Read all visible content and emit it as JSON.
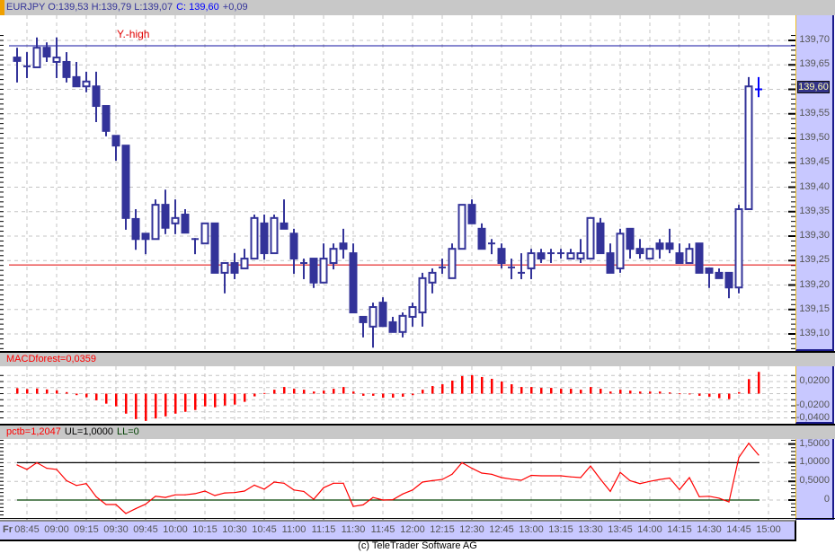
{
  "header": {
    "symbol_ohl": "EURJPY O:139,53 H:139,79 L:139,07",
    "close": "C: 139,60",
    "change": "+0,09",
    "accent": "#f0a000"
  },
  "price_panel": {
    "annotation": "Y.-high",
    "y_high": 139.689,
    "y_low": 139.241,
    "last_price_tag": "139,60",
    "axis_labels": [
      "139,70",
      "139,65",
      "139,60",
      "139,55",
      "139,50",
      "139,45",
      "139,40",
      "139,35",
      "139,30",
      "139,25",
      "139,20",
      "139,15",
      "139,10"
    ],
    "axis_values": [
      139.7,
      139.65,
      139.6,
      139.55,
      139.5,
      139.45,
      139.4,
      139.35,
      139.3,
      139.25,
      139.2,
      139.15,
      139.1
    ],
    "colors": {
      "candle": "#333399",
      "last": "#0000ff",
      "y_high_line": "#1010a0",
      "y_low_line": "#e00000",
      "annotation": "#e00000"
    },
    "candles_ohlc": [
      [
        139.665,
        139.685,
        139.614,
        139.658
      ],
      [
        139.647,
        139.676,
        139.623,
        139.647
      ],
      [
        139.645,
        139.706,
        139.645,
        139.685
      ],
      [
        139.685,
        139.696,
        139.656,
        139.667
      ],
      [
        139.656,
        139.706,
        139.623,
        139.665
      ],
      [
        139.656,
        139.676,
        139.614,
        139.625
      ],
      [
        139.625,
        139.656,
        139.606,
        139.606
      ],
      [
        139.606,
        139.636,
        139.594,
        139.616
      ],
      [
        139.606,
        139.636,
        139.533,
        139.566
      ],
      [
        139.566,
        139.566,
        139.504,
        139.515
      ],
      [
        139.505,
        139.505,
        139.454,
        139.485
      ],
      [
        139.485,
        139.485,
        139.313,
        139.337
      ],
      [
        139.335,
        139.355,
        139.272,
        139.294
      ],
      [
        139.305,
        139.305,
        139.263,
        139.294
      ],
      [
        139.294,
        139.375,
        139.294,
        139.364
      ],
      [
        139.364,
        139.395,
        139.304,
        139.317
      ],
      [
        139.326,
        139.375,
        139.304,
        139.337
      ],
      [
        139.344,
        139.355,
        139.307,
        139.307
      ],
      [
        139.294,
        139.296,
        139.263,
        139.294
      ],
      [
        139.285,
        139.326,
        139.285,
        139.326
      ],
      [
        139.326,
        139.326,
        139.225,
        139.225
      ],
      [
        139.225,
        139.245,
        139.183,
        139.245
      ],
      [
        139.245,
        139.265,
        139.212,
        139.225
      ],
      [
        139.234,
        139.274,
        139.234,
        139.254
      ],
      [
        139.254,
        139.344,
        139.254,
        139.337
      ],
      [
        139.326,
        139.344,
        139.252,
        139.265
      ],
      [
        139.265,
        139.344,
        139.265,
        139.337
      ],
      [
        139.326,
        139.375,
        139.315,
        139.315
      ],
      [
        139.305,
        139.315,
        139.223,
        139.254
      ],
      [
        139.245,
        139.254,
        139.212,
        139.245
      ],
      [
        139.254,
        139.254,
        139.194,
        139.205
      ],
      [
        139.205,
        139.285,
        139.205,
        139.254
      ],
      [
        139.245,
        139.285,
        139.232,
        139.274
      ],
      [
        139.285,
        139.315,
        139.254,
        139.274
      ],
      [
        139.265,
        139.285,
        139.144,
        139.144
      ],
      [
        139.135,
        139.135,
        139.093,
        139.124
      ],
      [
        139.115,
        139.164,
        139.072,
        139.155
      ],
      [
        139.164,
        139.175,
        139.116,
        139.116
      ],
      [
        139.124,
        139.135,
        139.104,
        139.104
      ],
      [
        139.104,
        139.144,
        139.093,
        139.137
      ],
      [
        139.135,
        139.164,
        139.115,
        139.155
      ],
      [
        139.144,
        139.225,
        139.115,
        139.214
      ],
      [
        139.205,
        139.234,
        139.183,
        139.225
      ],
      [
        139.236,
        139.254,
        139.223,
        139.236
      ],
      [
        139.214,
        139.285,
        139.214,
        139.274
      ],
      [
        139.274,
        139.364,
        139.274,
        139.364
      ],
      [
        139.364,
        139.375,
        139.326,
        139.326
      ],
      [
        139.315,
        139.326,
        139.274,
        139.274
      ],
      [
        139.285,
        139.294,
        139.263,
        139.285
      ],
      [
        139.274,
        139.285,
        139.234,
        139.245
      ],
      [
        139.236,
        139.254,
        139.212,
        139.236
      ],
      [
        139.225,
        139.265,
        139.212,
        139.225
      ],
      [
        139.234,
        139.274,
        139.212,
        139.265
      ],
      [
        139.265,
        139.274,
        139.245,
        139.254
      ],
      [
        139.265,
        139.274,
        139.245,
        139.265
      ],
      [
        139.265,
        139.274,
        139.254,
        139.265
      ],
      [
        139.254,
        139.274,
        139.254,
        139.265
      ],
      [
        139.254,
        139.294,
        139.245,
        139.265
      ],
      [
        139.254,
        139.337,
        139.254,
        139.337
      ],
      [
        139.326,
        139.337,
        139.265,
        139.265
      ],
      [
        139.265,
        139.285,
        139.225,
        139.225
      ],
      [
        139.234,
        139.315,
        139.225,
        139.305
      ],
      [
        139.315,
        139.315,
        139.254,
        139.274
      ],
      [
        139.274,
        139.294,
        139.254,
        139.265
      ],
      [
        139.254,
        139.274,
        139.254,
        139.274
      ],
      [
        139.285,
        139.294,
        139.254,
        139.274
      ],
      [
        139.285,
        139.315,
        139.265,
        139.274
      ],
      [
        139.265,
        139.285,
        139.245,
        139.245
      ],
      [
        139.245,
        139.285,
        139.245,
        139.274
      ],
      [
        139.285,
        139.285,
        139.225,
        139.225
      ],
      [
        139.234,
        139.234,
        139.194,
        139.225
      ],
      [
        139.225,
        139.234,
        139.214,
        139.214
      ],
      [
        139.225,
        139.225,
        139.173,
        139.195
      ],
      [
        139.195,
        139.364,
        139.183,
        139.355
      ],
      [
        139.355,
        139.625,
        139.355,
        139.606
      ],
      [
        139.6,
        139.625,
        139.584,
        139.6
      ]
    ]
  },
  "macd_panel": {
    "title": "MACDforest=0,0359",
    "axis_labels": [
      "0,0200",
      "-0,0200",
      "-0,0400"
    ],
    "axis_values": [
      0.02,
      -0.02,
      -0.04
    ],
    "color": "#ff0000",
    "values": [
      0.009,
      0.0075,
      0.0085,
      0.007,
      0.0055,
      0.0025,
      -0.0025,
      -0.006,
      -0.011,
      -0.0165,
      -0.021,
      -0.033,
      -0.042,
      -0.045,
      -0.041,
      -0.0375,
      -0.033,
      -0.03,
      -0.027,
      -0.021,
      -0.0225,
      -0.0195,
      -0.018,
      -0.0135,
      -0.0045,
      0.001,
      0.0065,
      0.011,
      0.008,
      0.0065,
      0.0035,
      0.005,
      0.008,
      0.011,
      0.0035,
      -0.0035,
      -0.0035,
      -0.0065,
      -0.0065,
      -0.005,
      -0.0025,
      0.0065,
      0.0125,
      0.0155,
      0.0215,
      0.029,
      0.0305,
      0.0275,
      0.0245,
      0.02,
      0.0155,
      0.011,
      0.011,
      0.0095,
      0.0095,
      0.008,
      0.008,
      0.0065,
      0.011,
      0.008,
      0.0035,
      0.0065,
      0.005,
      0.0035,
      0.0035,
      0.0035,
      0.002,
      0.0005,
      0.0002,
      -0.0035,
      -0.005,
      -0.0075,
      -0.009,
      0.0025,
      0.024,
      0.0359
    ]
  },
  "pctb_panel": {
    "title": "pctb=1,2047",
    "ul_label": "UL=1,0000",
    "ll_label": "LL=0",
    "ul": 1.0,
    "ll": 0,
    "axis_labels": [
      "1,5000",
      "1,0000",
      "0,5000",
      "0"
    ],
    "axis_values": [
      1.5,
      1.0,
      0.5,
      0
    ],
    "colors": {
      "line": "#ff0000",
      "ul": "#000000",
      "ll": "#004000"
    },
    "values": [
      0.94,
      0.82,
      1.0,
      0.85,
      0.82,
      0.52,
      0.39,
      0.44,
      0.09,
      -0.12,
      -0.12,
      -0.36,
      -0.23,
      -0.11,
      0.1,
      0.07,
      0.14,
      0.14,
      0.17,
      0.24,
      0.12,
      0.19,
      0.2,
      0.24,
      0.4,
      0.29,
      0.48,
      0.45,
      0.27,
      0.23,
      0.02,
      0.33,
      0.45,
      0.45,
      -0.17,
      -0.13,
      0.07,
      0,
      0.01,
      0.16,
      0.27,
      0.48,
      0.52,
      0.55,
      0.69,
      1.0,
      0.85,
      0.72,
      0.69,
      0.6,
      0.56,
      0.53,
      0.66,
      0.65,
      0.65,
      0.65,
      0.62,
      0.6,
      0.91,
      0.56,
      0.23,
      0.74,
      0.52,
      0.44,
      0.5,
      0.55,
      0.59,
      0.28,
      0.6,
      0.09,
      0.1,
      0.05,
      -0.05,
      1.14,
      1.52,
      1.2047
    ]
  },
  "time_axis": {
    "day": "Fr",
    "labels": [
      "08:45",
      "09:00",
      "09:15",
      "09:30",
      "09:45",
      "10:00",
      "10:15",
      "10:30",
      "10:45",
      "11:00",
      "11:15",
      "11:30",
      "11:45",
      "12:00",
      "12:15",
      "12:30",
      "12:45",
      "13:00",
      "13:15",
      "13:30",
      "13:45",
      "14:00",
      "14:15",
      "14:30",
      "14:45",
      "15:00"
    ]
  },
  "footer": {
    "copyright": "(c) TeleTrader Software AG"
  }
}
